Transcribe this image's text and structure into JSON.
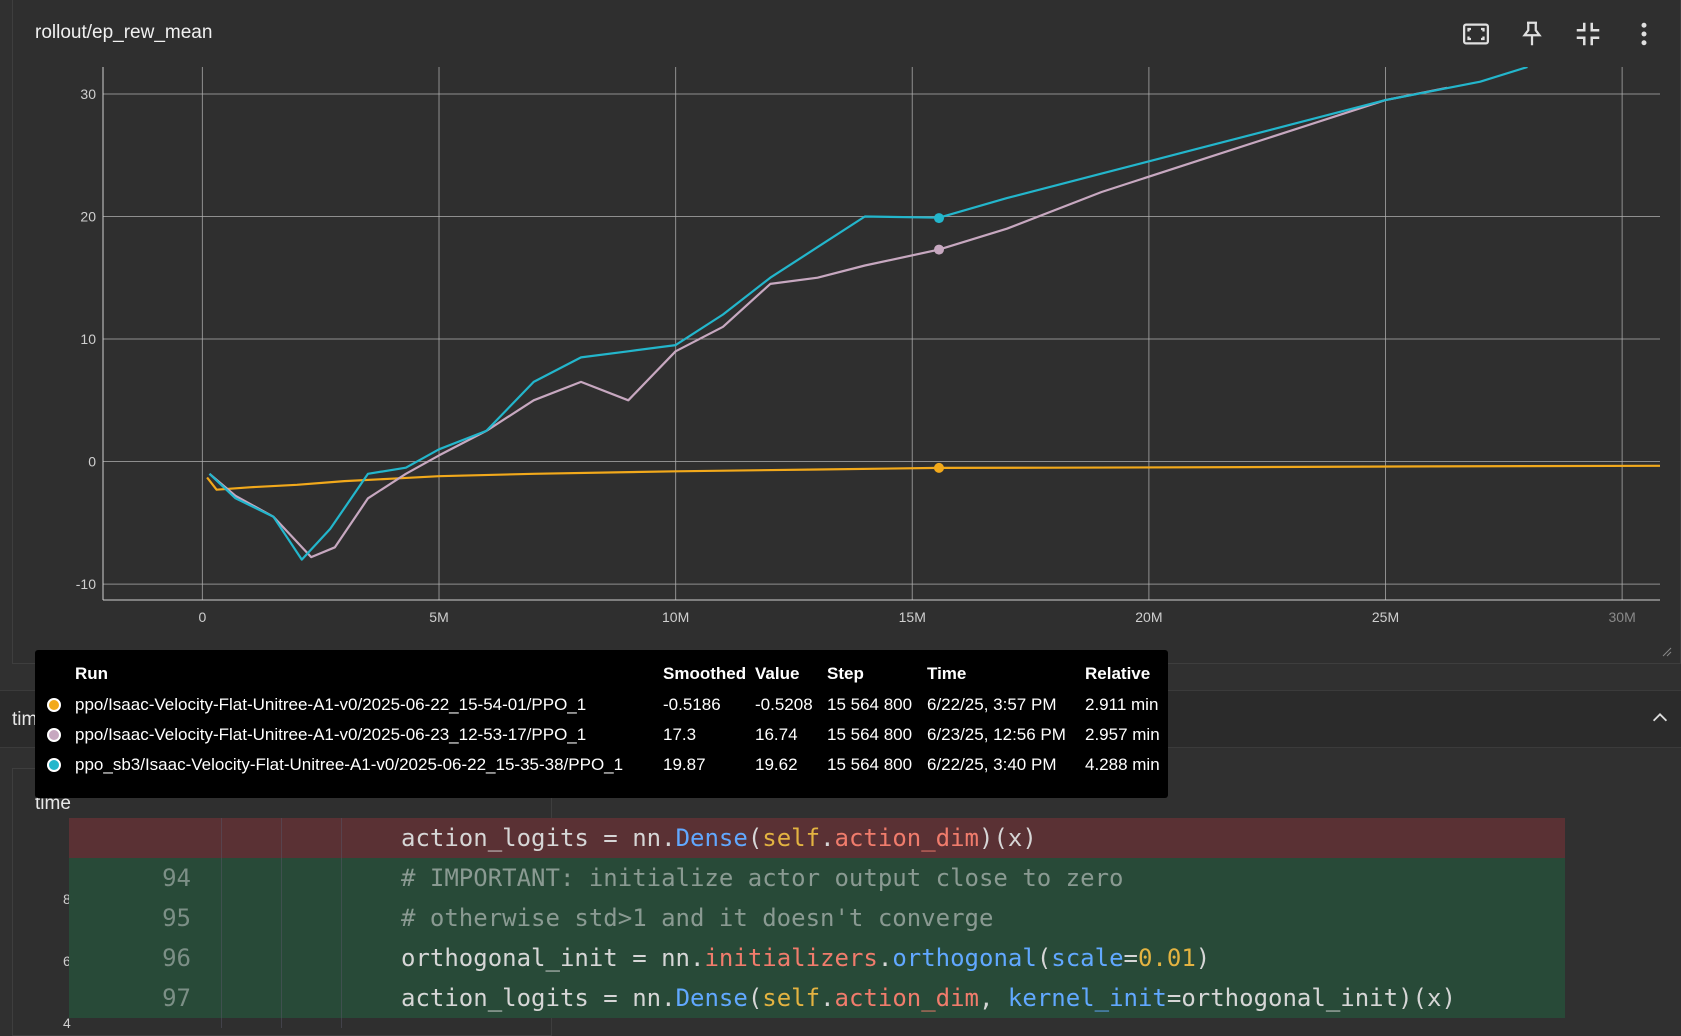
{
  "card": {
    "title": "rollout/ep_rew_mean",
    "toolbar": [
      {
        "name": "fit-domain-button",
        "icon": "fit-to-screen-icon"
      },
      {
        "name": "pin-button",
        "icon": "pin-icon"
      },
      {
        "name": "collapse-card-button",
        "icon": "collapse-icon"
      },
      {
        "name": "more-options-button",
        "icon": "more-vert-icon"
      }
    ]
  },
  "chart_data": {
    "type": "line",
    "title": "rollout/ep_rew_mean",
    "xlim": [
      -2100000,
      30800000
    ],
    "ylim": [
      -11.3,
      32.2
    ],
    "x_ticks": [
      0,
      5000000,
      10000000,
      15000000,
      20000000,
      25000000,
      30000000
    ],
    "x_tick_labels": [
      "0",
      "5M",
      "10M",
      "15M",
      "20M",
      "25M",
      "30M"
    ],
    "y_ticks": [
      -10,
      0,
      10,
      20,
      30
    ],
    "y_tick_labels": [
      "-10",
      "0",
      "10",
      "20",
      "30"
    ],
    "grid": true,
    "hover_step": 15564800,
    "series": [
      {
        "name": "ppo/Isaac-Velocity-Flat-Unitree-A1-v0/2025-06-22_15-54-01/PPO_1",
        "color": "#f2a91b",
        "x": [
          100000,
          300000,
          1000000,
          2000000,
          3000000,
          4000000,
          5000000,
          7000000,
          10000000,
          13000000,
          15564800,
          18000000,
          22000000,
          26000000,
          30800000
        ],
        "y": [
          -1.3,
          -2.3,
          -2.1,
          -1.9,
          -1.6,
          -1.4,
          -1.2,
          -1.0,
          -0.8,
          -0.65,
          -0.52,
          -0.5,
          -0.45,
          -0.4,
          -0.35
        ]
      },
      {
        "name": "ppo/Isaac-Velocity-Flat-Unitree-A1-v0/2025-06-23_12-53-17/PPO_1",
        "color": "#c7a8c0",
        "x": [
          150000,
          700000,
          1500000,
          2300000,
          2800000,
          3500000,
          4300000,
          5000000,
          6000000,
          7000000,
          8000000,
          9000000,
          10000000,
          11000000,
          12000000,
          13000000,
          14000000,
          15564800,
          17000000,
          19000000,
          21000000,
          23000000,
          25000000,
          26300000
        ],
        "y": [
          -1.0,
          -2.8,
          -4.5,
          -7.8,
          -7.0,
          -3.0,
          -1.0,
          0.5,
          2.5,
          5.0,
          6.5,
          5.0,
          9.0,
          11.0,
          14.5,
          15.0,
          16.0,
          17.3,
          19.0,
          22.0,
          24.5,
          27.0,
          29.5,
          30.5
        ]
      },
      {
        "name": "ppo_sb3/Isaac-Velocity-Flat-Unitree-A1-v0/2025-06-22_15-35-38/PPO_1",
        "color": "#23b6cc",
        "x": [
          150000,
          700000,
          1500000,
          2100000,
          2700000,
          3500000,
          4300000,
          5000000,
          6000000,
          7000000,
          8000000,
          9000000,
          10000000,
          11000000,
          12000000,
          13000000,
          14000000,
          15564800,
          17000000,
          19000000,
          21000000,
          23000000,
          25000000,
          27000000,
          28000000
        ],
        "y": [
          -1.0,
          -3.0,
          -4.5,
          -8.0,
          -5.5,
          -1.0,
          -0.5,
          1.0,
          2.5,
          6.5,
          8.5,
          9.0,
          9.5,
          12.0,
          15.0,
          17.5,
          20.0,
          19.9,
          21.5,
          23.5,
          25.5,
          27.5,
          29.5,
          31.0,
          32.2
        ]
      }
    ]
  },
  "tooltip": {
    "headers": [
      "Run",
      "Smoothed",
      "Value",
      "Step",
      "Time",
      "Relative"
    ],
    "rows": [
      {
        "color": "#f2a91b",
        "run": "ppo/Isaac-Velocity-Flat-Unitree-A1-v0/2025-06-22_15-54-01/PPO_1",
        "smoothed": "-0.5186",
        "value": "-0.5208",
        "step": "15 564 800",
        "time": "6/22/25, 3:57 PM",
        "relative": "2.911 min"
      },
      {
        "color": "#c7a8c0",
        "run": "ppo/Isaac-Velocity-Flat-Unitree-A1-v0/2025-06-23_12-53-17/PPO_1",
        "smoothed": "17.3",
        "value": "16.74",
        "step": "15 564 800",
        "time": "6/23/25, 12:56 PM",
        "relative": "2.957 min"
      },
      {
        "color": "#23b6cc",
        "run": "ppo_sb3/Isaac-Velocity-Flat-Unitree-A1-v0/2025-06-22_15-35-38/PPO_1",
        "smoothed": "19.87",
        "value": "19.62",
        "step": "15 564 800",
        "time": "6/22/25, 3:40 PM",
        "relative": "4.288 min"
      }
    ]
  },
  "section": {
    "label": "tim"
  },
  "card2": {
    "title": "time",
    "y_labels": [
      "8",
      "6",
      "4"
    ]
  },
  "code": {
    "lines": [
      {
        "type": "removed",
        "num": "",
        "text": "action_logits = nn.Dense(self.action_dim)(x)"
      },
      {
        "type": "added",
        "num": "94",
        "text": "# IMPORTANT: initialize actor output close to zero"
      },
      {
        "type": "added",
        "num": "95",
        "text": "# otherwise std>1 and it doesn't converge"
      },
      {
        "type": "added",
        "num": "96",
        "text": "orthogonal_init = nn.initializers.orthogonal(scale=0.01)"
      },
      {
        "type": "added",
        "num": "97",
        "text": "action_logits = nn.Dense(self.action_dim, kernel_init=orthogonal_init)(x)"
      }
    ]
  }
}
